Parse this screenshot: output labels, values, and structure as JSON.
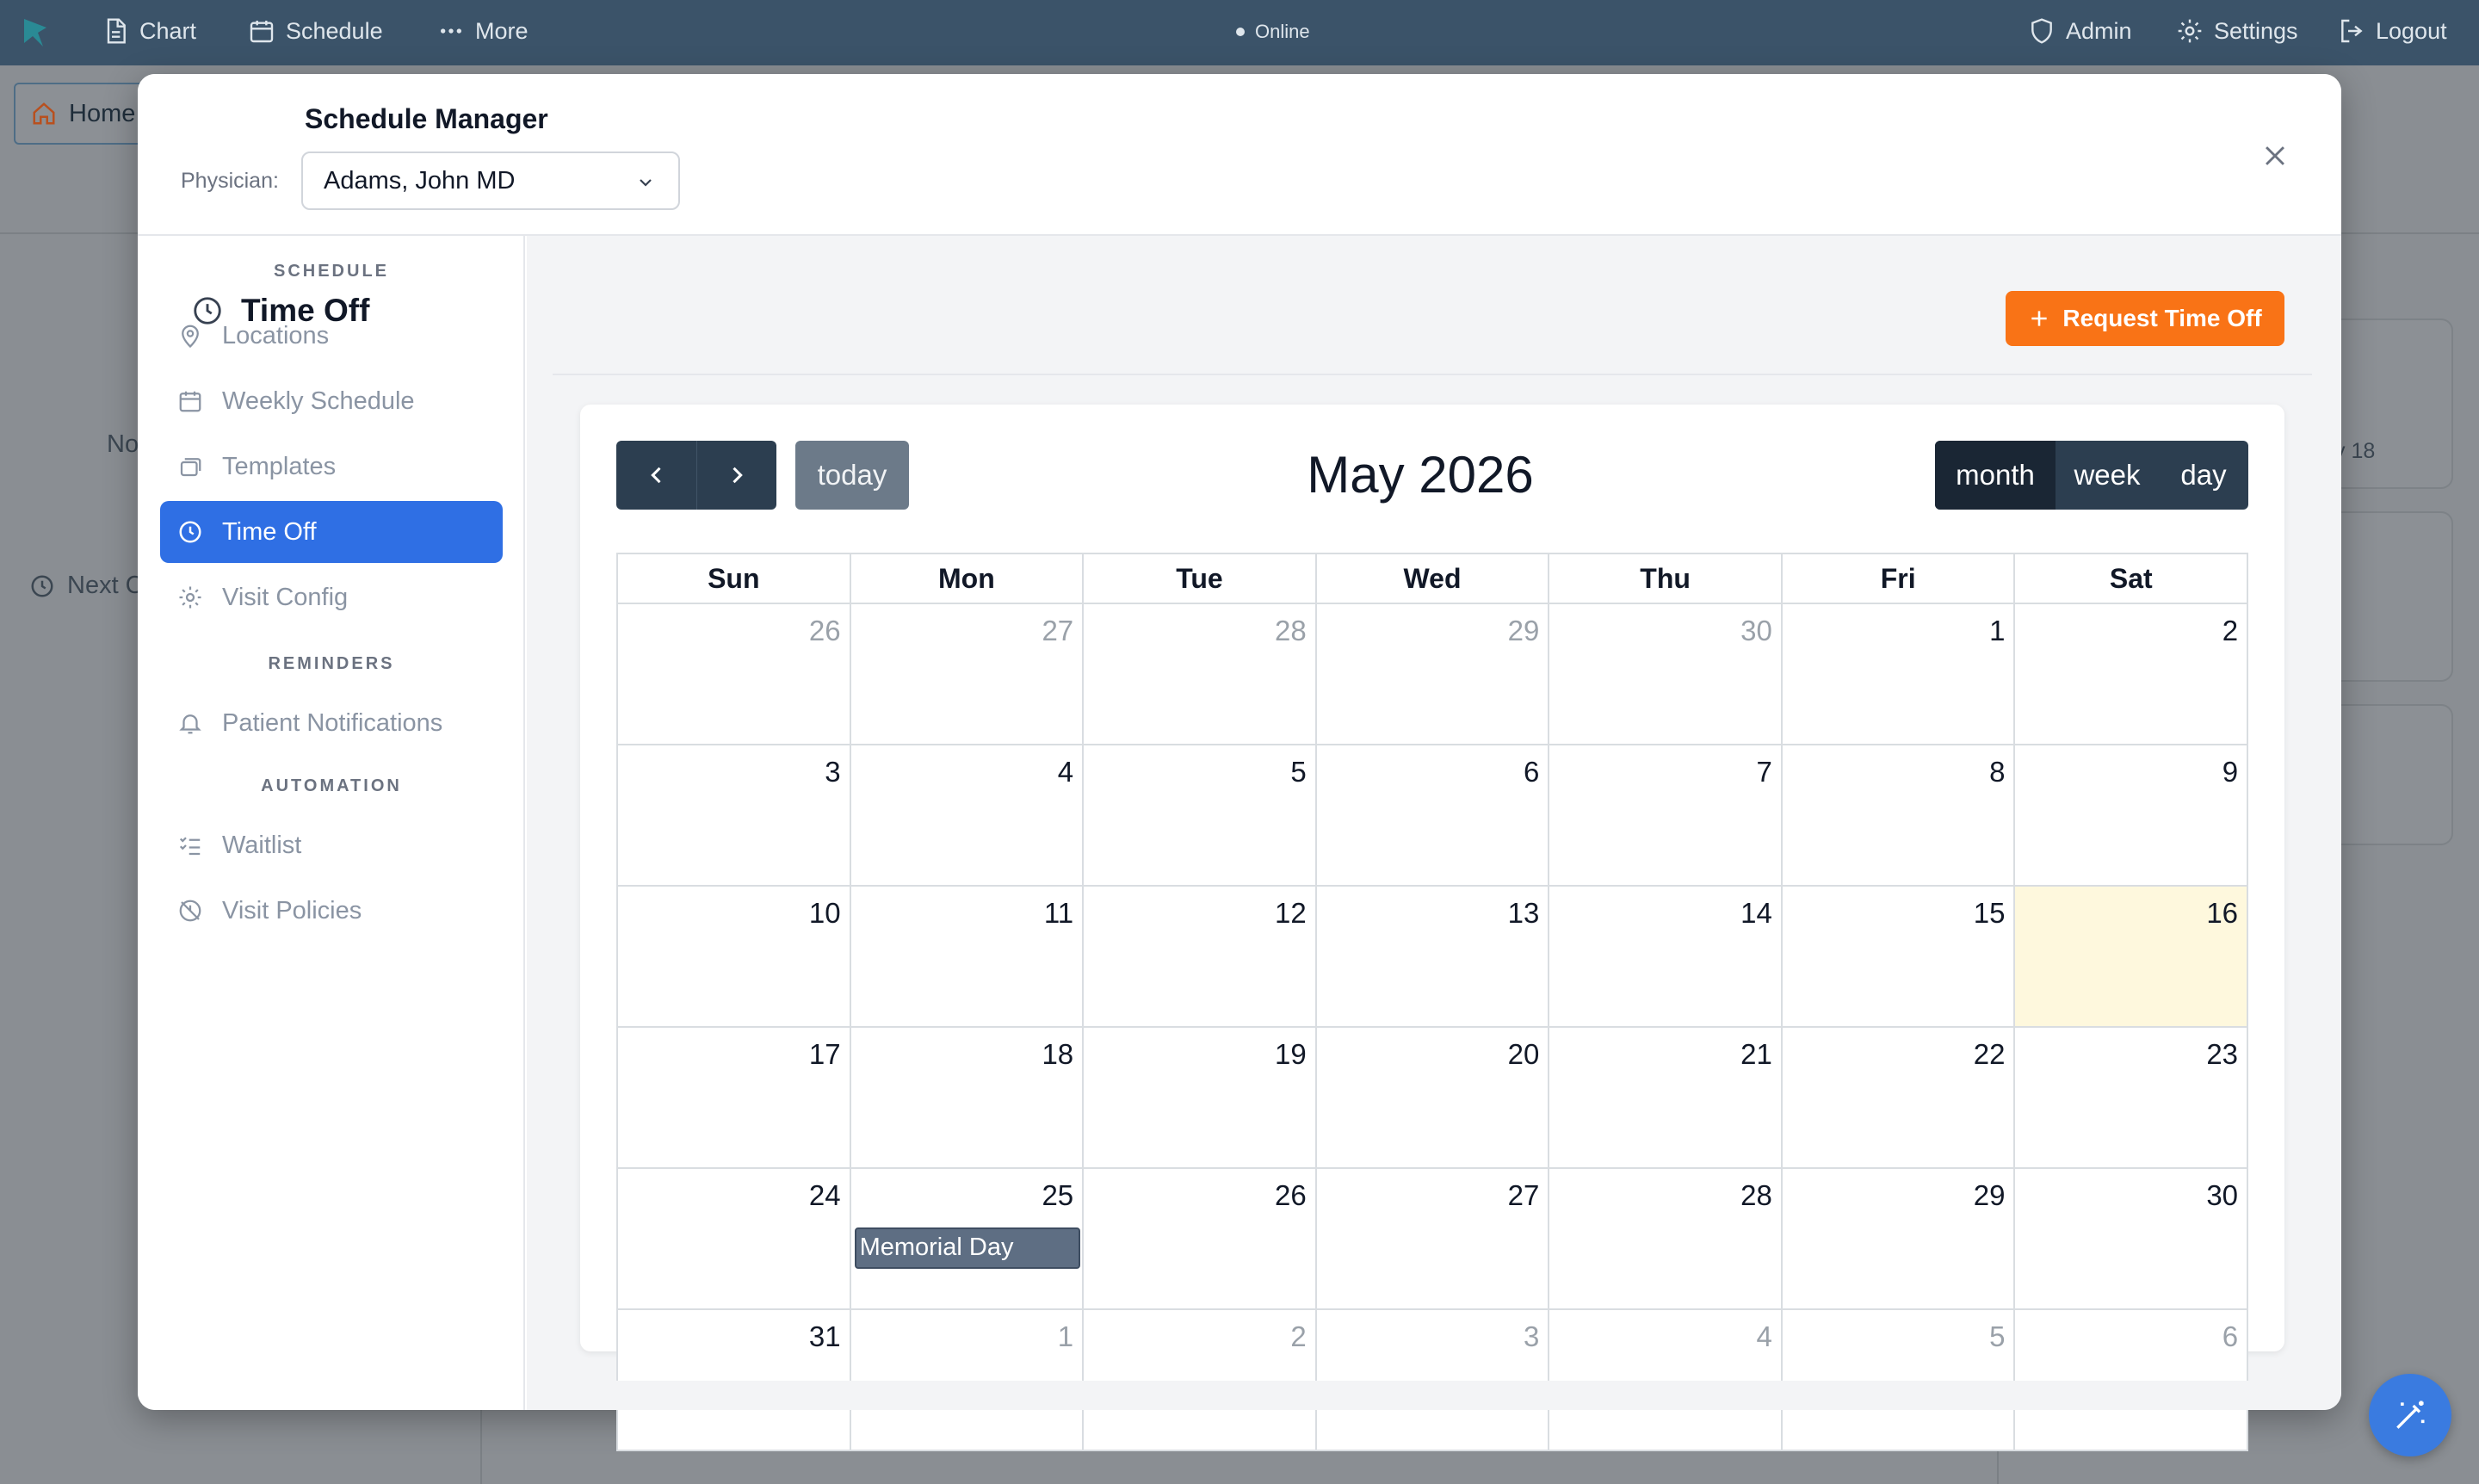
{
  "topbar": {
    "nav": [
      {
        "label": "Chart",
        "icon": "document-icon"
      },
      {
        "label": "Schedule",
        "icon": "calendar-icon"
      },
      {
        "label": "More",
        "icon": "more-dots-icon"
      }
    ],
    "status": "Online",
    "right": [
      {
        "label": "Admin",
        "icon": "shield-icon"
      },
      {
        "label": "Settings",
        "icon": "gear-icon"
      },
      {
        "label": "Logout",
        "icon": "logout-icon"
      }
    ]
  },
  "background": {
    "home_tab": "Home",
    "left_text_1": "No",
    "left_text_2": "Next C",
    "right_text": "y 18"
  },
  "modal": {
    "title": "Schedule Manager",
    "physician_label": "Physician:",
    "physician_value": "Adams, John MD"
  },
  "sidebar": {
    "sections": [
      {
        "title": "SCHEDULE",
        "items": [
          {
            "label": "Locations",
            "icon": "map-pin-icon"
          },
          {
            "label": "Weekly Schedule",
            "icon": "calendar-icon"
          },
          {
            "label": "Templates",
            "icon": "stack-icon"
          },
          {
            "label": "Time Off",
            "icon": "clock-icon",
            "active": true
          },
          {
            "label": "Visit Config",
            "icon": "gear-icon"
          }
        ]
      },
      {
        "title": "REMINDERS",
        "items": [
          {
            "label": "Patient Notifications",
            "icon": "bell-icon"
          }
        ]
      },
      {
        "title": "AUTOMATION",
        "items": [
          {
            "label": "Waitlist",
            "icon": "list-check-icon"
          },
          {
            "label": "Visit Policies",
            "icon": "clock-off-icon"
          }
        ]
      }
    ]
  },
  "main": {
    "section_title": "Time Off",
    "request_button": "Request Time Off"
  },
  "calendar": {
    "title": "May 2026",
    "today_label": "today",
    "views": [
      "month",
      "week",
      "day"
    ],
    "active_view": "month",
    "weekdays": [
      "Sun",
      "Mon",
      "Tue",
      "Wed",
      "Thu",
      "Fri",
      "Sat"
    ],
    "weeks": [
      [
        {
          "d": "26",
          "other": true
        },
        {
          "d": "27",
          "other": true
        },
        {
          "d": "28",
          "other": true
        },
        {
          "d": "29",
          "other": true
        },
        {
          "d": "30",
          "other": true
        },
        {
          "d": "1"
        },
        {
          "d": "2"
        }
      ],
      [
        {
          "d": "3"
        },
        {
          "d": "4"
        },
        {
          "d": "5"
        },
        {
          "d": "6"
        },
        {
          "d": "7"
        },
        {
          "d": "8"
        },
        {
          "d": "9"
        }
      ],
      [
        {
          "d": "10"
        },
        {
          "d": "11"
        },
        {
          "d": "12"
        },
        {
          "d": "13"
        },
        {
          "d": "14"
        },
        {
          "d": "15"
        },
        {
          "d": "16",
          "today": true
        }
      ],
      [
        {
          "d": "17"
        },
        {
          "d": "18"
        },
        {
          "d": "19"
        },
        {
          "d": "20"
        },
        {
          "d": "21"
        },
        {
          "d": "22"
        },
        {
          "d": "23"
        }
      ],
      [
        {
          "d": "24"
        },
        {
          "d": "25",
          "event": "Memorial Day"
        },
        {
          "d": "26"
        },
        {
          "d": "27"
        },
        {
          "d": "28"
        },
        {
          "d": "29"
        },
        {
          "d": "30"
        }
      ],
      [
        {
          "d": "31"
        },
        {
          "d": "1",
          "other": true
        },
        {
          "d": "2",
          "other": true
        },
        {
          "d": "3",
          "other": true
        },
        {
          "d": "4",
          "other": true
        },
        {
          "d": "5",
          "other": true
        },
        {
          "d": "6",
          "other": true
        }
      ]
    ]
  },
  "colors": {
    "topbar": "#3b5369",
    "active_sidebar": "#2f6fe4",
    "request_button": "#f97316",
    "calendar_nav": "#2c3e50",
    "today_cell": "#fef8dd",
    "event": "#5e6e83"
  }
}
